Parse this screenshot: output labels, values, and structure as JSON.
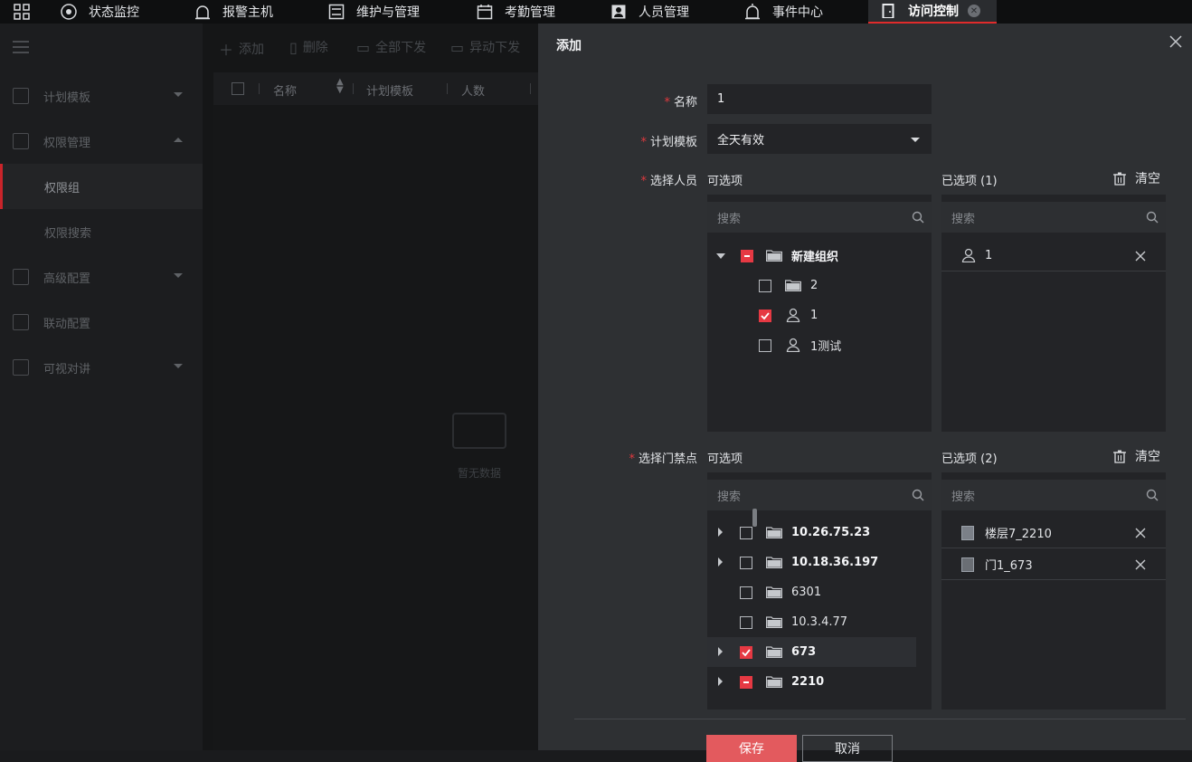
{
  "topbar": {
    "tabs": [
      {
        "label": "状态监控",
        "icon": "grid-icon"
      },
      {
        "label": "报警主机",
        "icon": "alarm-icon"
      },
      {
        "label": "维护与管理",
        "icon": "maintenance-icon"
      },
      {
        "label": "考勤管理",
        "icon": "calendar-icon"
      },
      {
        "label": "人员管理",
        "icon": "person-card-icon"
      },
      {
        "label": "事件中心",
        "icon": "siren-icon"
      },
      {
        "label": "访问控制",
        "icon": "door-icon",
        "active": true
      }
    ]
  },
  "sidebar": {
    "items": [
      {
        "label": "计划模板"
      },
      {
        "label": "权限管理"
      },
      {
        "label": "权限组"
      },
      {
        "label": "权限搜索"
      },
      {
        "label": "高级配置"
      },
      {
        "label": "联动配置"
      },
      {
        "label": "可视对讲"
      }
    ]
  },
  "toolbar": {
    "add": "添加",
    "delete": "删除",
    "push_all": "全部下发",
    "push_changed": "异动下发"
  },
  "table": {
    "columns": [
      "名称",
      "计划模板",
      "人数"
    ],
    "empty_text": "暂无数据"
  },
  "dialog": {
    "title": "添加",
    "name_label": "名称",
    "name_value": "1",
    "template_label": "计划模板",
    "template_value": "全天有效",
    "person_label": "选择人员",
    "door_label": "选择门禁点",
    "available_label": "可选项",
    "selected_person_label": "已选项 (1)",
    "selected_door_label": "已选项 (2)",
    "clear_label": "清空",
    "search_placeholder": "搜索",
    "person_tree": [
      {
        "label": "新建组织",
        "type": "folder",
        "state": "partial"
      },
      {
        "label": "2",
        "type": "folder",
        "state": "off"
      },
      {
        "label": "1",
        "type": "person",
        "state": "on"
      },
      {
        "label": "1测试",
        "type": "person",
        "state": "off"
      }
    ],
    "selected_persons": [
      "1"
    ],
    "door_tree": [
      {
        "label": "10.26.75.23",
        "state": "off"
      },
      {
        "label": "10.18.36.197",
        "state": "off"
      },
      {
        "label": "6301",
        "state": "off"
      },
      {
        "label": "10.3.4.77",
        "state": "off"
      },
      {
        "label": "673",
        "state": "on"
      },
      {
        "label": "2210",
        "state": "partial"
      }
    ],
    "selected_doors": [
      "楼层7_2210",
      "门1_673"
    ],
    "save_label": "保存",
    "cancel_label": "取消"
  },
  "colors": {
    "accent": "#e63943",
    "panel_bg": "#2e3033",
    "box_bg": "#232427"
  }
}
